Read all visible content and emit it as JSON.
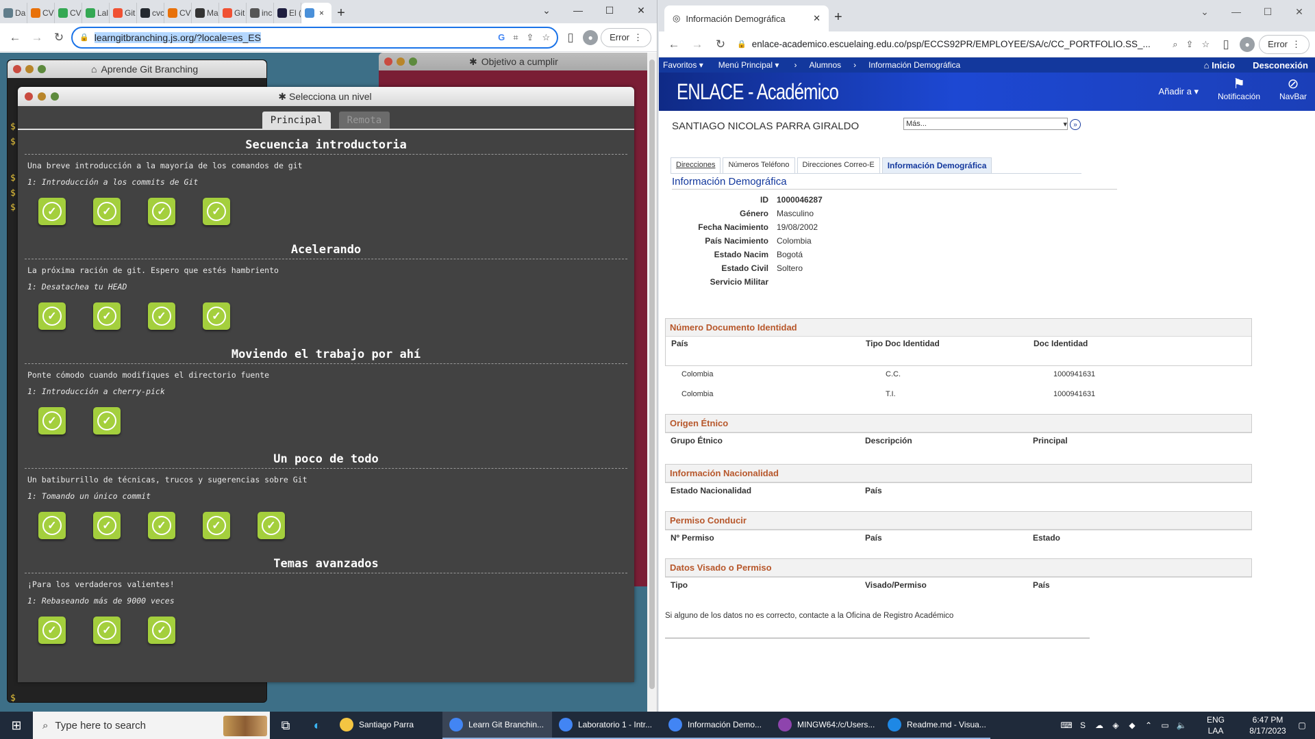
{
  "left_browser": {
    "tabs": [
      {
        "label": "Da",
        "color": "#607d8b"
      },
      {
        "label": "CV",
        "color": "#e8710a"
      },
      {
        "label": "CV",
        "color": "#34a853"
      },
      {
        "label": "Lal",
        "color": "#34a853"
      },
      {
        "label": "Git",
        "color": "#f05133"
      },
      {
        "label": "cvc",
        "color": "#24292f"
      },
      {
        "label": "CV",
        "color": "#e8710a"
      },
      {
        "label": "Ma",
        "color": "#333333"
      },
      {
        "label": "Git",
        "color": "#f05133"
      },
      {
        "label": "inc",
        "color": "#555555"
      },
      {
        "label": "El (",
        "color": "#1e1e3f"
      }
    ],
    "active_tab_close": "×",
    "new_tab": "+",
    "url": "learngitbranching.js.org/?locale=es_ES",
    "error_label": "Error"
  },
  "learngit": {
    "terminal_title": "Aprende Git Branching",
    "goal_title": "Objetivo a cumplir",
    "level_window_title": "Selecciona un nivel",
    "tabs": [
      "Principal",
      "Remota"
    ],
    "prompt_symbol": "$",
    "check_glyph": "✓",
    "sequences": [
      {
        "title": "Secuencia introductoria",
        "description": "Una breve introducción a la mayoría de los comandos de git",
        "first_level": "1: Introducción a los commits de Git",
        "levels": 4
      },
      {
        "title": "Acelerando",
        "description": "La próxima ración de git. Espero que estés hambriento",
        "first_level": "1: Desatachea tu HEAD",
        "levels": 4
      },
      {
        "title": "Moviendo el trabajo por ahí",
        "description": "Ponte cómodo cuando modifiques el directorio fuente",
        "first_level": "1: Introducción a cherry-pick",
        "levels": 2
      },
      {
        "title": "Un poco de todo",
        "description": "Un batiburrillo de técnicas, trucos y sugerencias sobre Git",
        "first_level": "1: Tomando un único commit",
        "levels": 5
      },
      {
        "title": "Temas avanzados",
        "description": "¡Para los verdaderos valientes!",
        "first_level": "1: Rebaseando más de 9000 veces",
        "levels": 3
      }
    ]
  },
  "right_browser": {
    "tab_title": "Información Demográfica",
    "url": "enlace-academico.escuelaing.edu.co/psp/ECCS92PR/EMPLOYEE/SA/c/CC_PORTFOLIO.SS_...",
    "error_label": "Error"
  },
  "peoplesoft": {
    "nav": {
      "favoritos": "Favoritos",
      "menu_principal": "Menú Principal",
      "breadcrumb": [
        "Alumnos",
        "Información Demográfica"
      ],
      "inicio": "Inicio",
      "desconexion": "Desconexión"
    },
    "logo": "ENLACE - Académico",
    "anadir": "Añadir a",
    "notificacion": "Notificación",
    "navbar": "NavBar",
    "student_name": "SANTIAGO NICOLAS PARRA GIRALDO",
    "mas_select": "Más...",
    "tabs": [
      "Direcciones",
      "Números Teléfono",
      "Direcciones Correo-E",
      "Información Demográfica"
    ],
    "section_title": "Información Demográfica",
    "fields": [
      {
        "label": "ID",
        "value": "1000046287"
      },
      {
        "label": "Género",
        "value": "Masculino"
      },
      {
        "label": "Fecha Nacimiento",
        "value": "19/08/2002"
      },
      {
        "label": "País Nacimiento",
        "value": "Colombia"
      },
      {
        "label": "Estado Nacim",
        "value": "Bogotá"
      },
      {
        "label": "Estado Civil",
        "value": "Soltero"
      },
      {
        "label": "Servicio Militar",
        "value": ""
      }
    ],
    "doc_section": {
      "title": "Número Documento Identidad",
      "columns": [
        "País",
        "Tipo Doc Identidad",
        "Doc Identidad"
      ],
      "rows": [
        [
          "Colombia",
          "C.C.",
          "1000941631"
        ],
        [
          "Colombia",
          "T.I.",
          "1000941631"
        ]
      ]
    },
    "etnico": {
      "title": "Origen Étnico",
      "columns": [
        "Grupo Étnico",
        "Descripción",
        "Principal"
      ]
    },
    "nacionalidad": {
      "title": "Información Nacionalidad",
      "columns": [
        "Estado Nacionalidad",
        "País",
        ""
      ]
    },
    "permiso": {
      "title": "Permiso Conducir",
      "columns": [
        "Nº Permiso",
        "País",
        "Estado"
      ]
    },
    "visado": {
      "title": "Datos Visado o Permiso",
      "columns": [
        "Tipo",
        "Visado/Permiso",
        "País"
      ]
    },
    "footnote": "Si alguno de los datos no es correcto, contacte a la Oficina de Registro Académico"
  },
  "taskbar": {
    "search_placeholder": "Type here to search",
    "apps": [
      {
        "label": "Santiago Parra",
        "color": "#f4c542",
        "state": "none"
      },
      {
        "label": "Learn Git Branchin...",
        "color": "#4285f4",
        "state": "active"
      },
      {
        "label": "Laboratorio 1 - Intr...",
        "color": "#4285f4",
        "state": "open"
      },
      {
        "label": "Información Demo...",
        "color": "#4285f4",
        "state": "open"
      },
      {
        "label": "MINGW64:/c/Users...",
        "color": "#8e44ad",
        "state": "open"
      },
      {
        "label": "Readme.md - Visua...",
        "color": "#1e88e5",
        "state": "open"
      }
    ],
    "lang_top": "ENG",
    "lang_bottom": "LAA",
    "time": "6:47 PM",
    "date": "8/17/2023"
  }
}
